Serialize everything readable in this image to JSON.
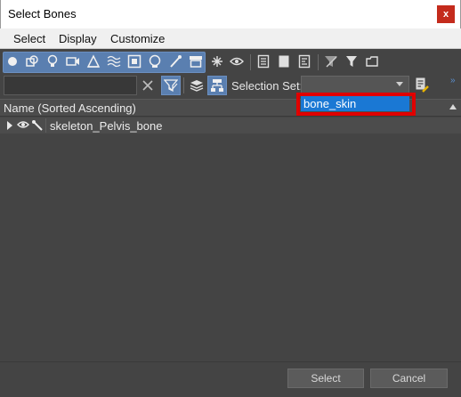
{
  "window": {
    "title": "Select Bones",
    "close_glyph": "x"
  },
  "menu": [
    {
      "label": "Select"
    },
    {
      "label": "Display"
    },
    {
      "label": "Customize"
    }
  ],
  "toolbar": {
    "icons": [
      "geometry-filter-icon",
      "shapes-filter-icon",
      "lights-filter-icon",
      "cameras-filter-icon",
      "helpers-filter-icon",
      "spacewarps-filter-icon",
      "groups-filter-icon",
      "xrefs-filter-icon",
      "bones-filter-icon",
      "containers-filter-icon",
      "frozen-icon",
      "hidden-icon",
      "select-all-icon",
      "select-none-icon",
      "select-invert-icon",
      "filter-icon",
      "funnel-icon",
      "layers-icon"
    ]
  },
  "filter": {
    "search_value": "",
    "selection_set_label": "Selection Set:",
    "selection_set_value": ""
  },
  "dropdown": {
    "items": [
      "bone_skin"
    ]
  },
  "list": {
    "header": "Name (Sorted Ascending)",
    "rows": [
      {
        "name": "skeleton_Pelvis_bone"
      }
    ]
  },
  "footer": {
    "select_label": "Select",
    "cancel_label": "Cancel"
  },
  "colors": {
    "accent": "#5a7fb0",
    "dropdown_highlight": "#1a78d4",
    "annotation_box": "#e00000",
    "background": "#444444"
  }
}
